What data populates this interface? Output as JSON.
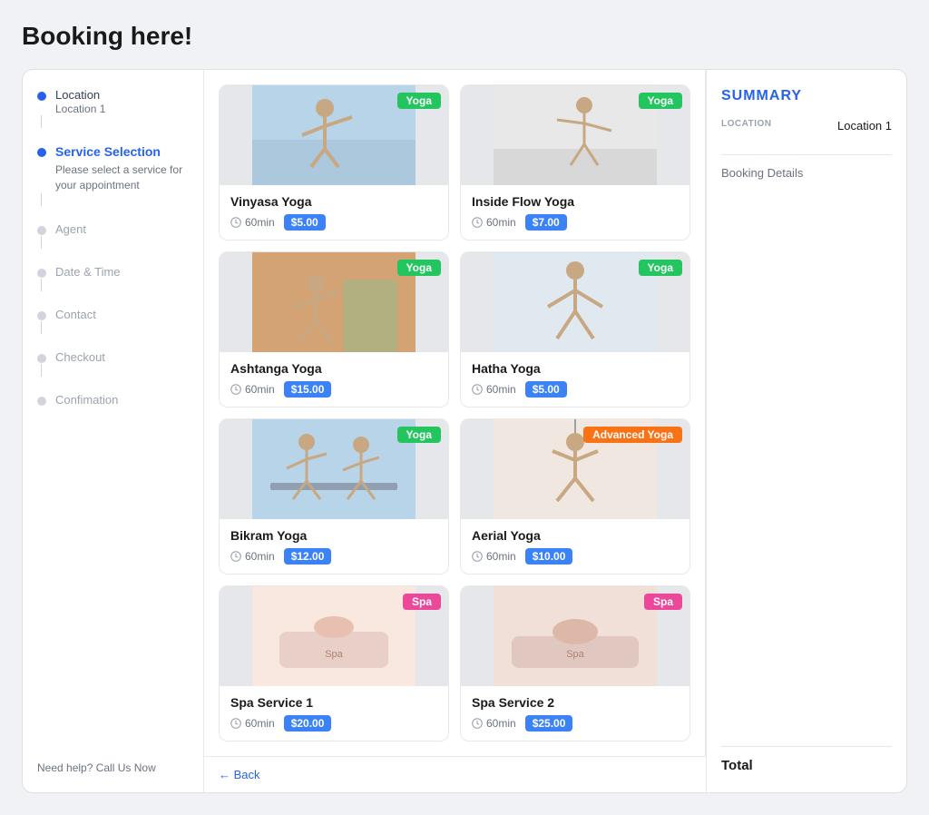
{
  "page": {
    "title": "Booking here!"
  },
  "sidebar": {
    "steps": [
      {
        "id": "location",
        "label": "Location",
        "sublabel": "Location 1",
        "state": "completed"
      },
      {
        "id": "service",
        "label": "Service Selection",
        "description": "Please select a service for your appointment",
        "state": "active"
      },
      {
        "id": "agent",
        "label": "Agent",
        "state": "inactive"
      },
      {
        "id": "datetime",
        "label": "Date & Time",
        "state": "inactive"
      },
      {
        "id": "contact",
        "label": "Contact",
        "state": "inactive"
      },
      {
        "id": "checkout",
        "label": "Checkout",
        "state": "inactive"
      },
      {
        "id": "confirmation",
        "label": "Confimation",
        "state": "inactive"
      }
    ],
    "help_text": "Need help? Call Us Now"
  },
  "services": [
    {
      "id": "vinyasa",
      "name": "Vinyasa Yoga",
      "duration": "60min",
      "price": "$5.00",
      "tag": "Yoga",
      "tag_type": "yoga",
      "img_class": "img-vinyasa"
    },
    {
      "id": "inside-flow",
      "name": "Inside Flow Yoga",
      "duration": "60min",
      "price": "$7.00",
      "tag": "Yoga",
      "tag_type": "yoga",
      "img_class": "img-inside-flow"
    },
    {
      "id": "ashtanga",
      "name": "Ashtanga Yoga",
      "duration": "60min",
      "price": "$15.00",
      "tag": "Yoga",
      "tag_type": "yoga",
      "img_class": "img-ashtanga"
    },
    {
      "id": "hatha",
      "name": "Hatha Yoga",
      "duration": "60min",
      "price": "$5.00",
      "tag": "Yoga",
      "tag_type": "yoga",
      "img_class": "img-hatha"
    },
    {
      "id": "bikram",
      "name": "Bikram Yoga",
      "duration": "60min",
      "price": "$12.00",
      "tag": "Yoga",
      "tag_type": "yoga",
      "img_class": "img-bikram"
    },
    {
      "id": "aerial",
      "name": "Aerial Yoga",
      "duration": "60min",
      "price": "$10.00",
      "tag": "Advanced Yoga",
      "tag_type": "advanced",
      "img_class": "img-aerial"
    },
    {
      "id": "spa1",
      "name": "Spa Service 1",
      "duration": "60min",
      "price": "$20.00",
      "tag": "Spa",
      "tag_type": "spa",
      "img_class": "img-spa1"
    },
    {
      "id": "spa2",
      "name": "Spa Service 2",
      "duration": "60min",
      "price": "$25.00",
      "tag": "Spa",
      "tag_type": "spa",
      "img_class": "img-spa2"
    }
  ],
  "summary": {
    "title": "SUMMARY",
    "location_label": "LOCATION",
    "location_value": "Location 1",
    "booking_details_label": "Booking Details",
    "total_label": "Total"
  },
  "navigation": {
    "back_label": "← Back"
  }
}
